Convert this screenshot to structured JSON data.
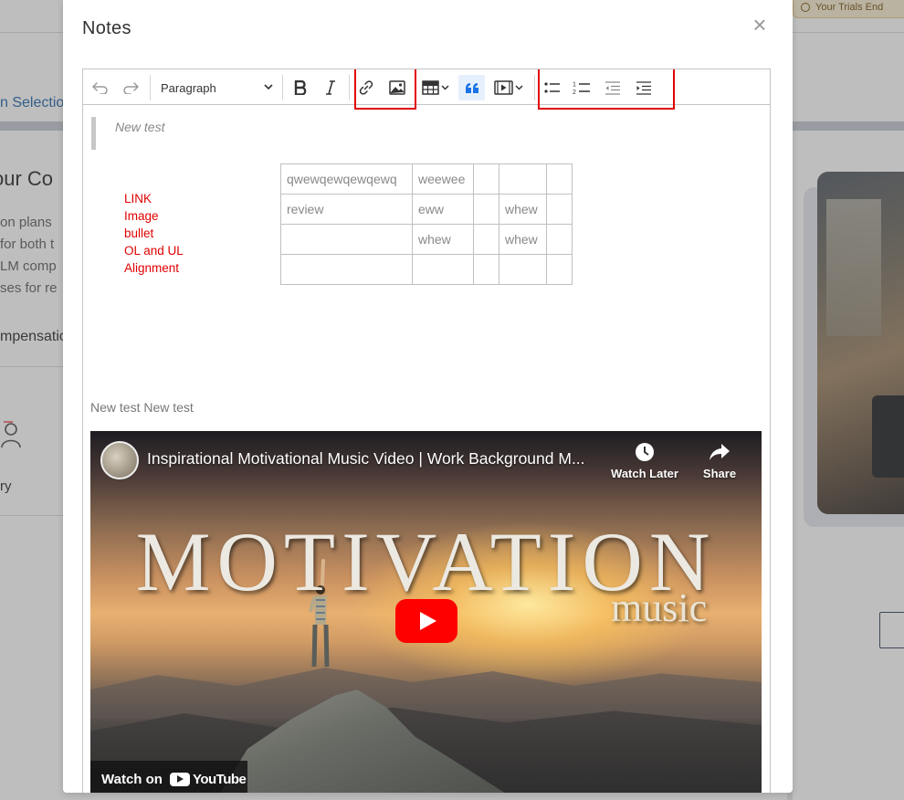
{
  "background": {
    "trial_banner": "Your Trials End",
    "selection_text": "n Selectio",
    "heading": "our Co",
    "lines": [
      "on plans",
      "for both t",
      "LM comp",
      "ses for re"
    ],
    "compensation": "mpensatio",
    "category": "ry"
  },
  "modal": {
    "title": "Notes",
    "close": "×"
  },
  "toolbar": {
    "paragraph_label": "Paragraph",
    "icons": [
      "undo-icon",
      "redo-icon",
      "bold-icon",
      "italic-icon",
      "link-icon",
      "image-icon",
      "table-icon",
      "blockquote-icon",
      "media-icon",
      "bulleted-list-icon",
      "numbered-list-icon",
      "outdent-icon",
      "indent-icon"
    ]
  },
  "content": {
    "blockquote": "New test",
    "red_notes": [
      "LINK",
      "Image",
      "bullet",
      "OL and UL",
      "Alignment"
    ],
    "table": [
      [
        "qwewqewqewqewq",
        "weewee",
        "",
        "",
        ""
      ],
      [
        "review",
        "eww",
        "",
        "whew",
        ""
      ],
      [
        "",
        "whew",
        "",
        "whew",
        ""
      ],
      [
        "",
        "",
        "",
        "",
        ""
      ]
    ],
    "paragraph": "New test New test"
  },
  "video": {
    "title": "Inspirational Motivational Music Video | Work Background M...",
    "watch_later": "Watch Later",
    "share": "Share",
    "overlay_title": "MOTIVATION",
    "overlay_subtitle": "music",
    "watch_on": "Watch on",
    "youtube": "YouTube"
  },
  "colors": {
    "annotation_red": "#e00000",
    "active_button_bg": "#e6f0fd",
    "youtube_red": "#ff0000"
  }
}
